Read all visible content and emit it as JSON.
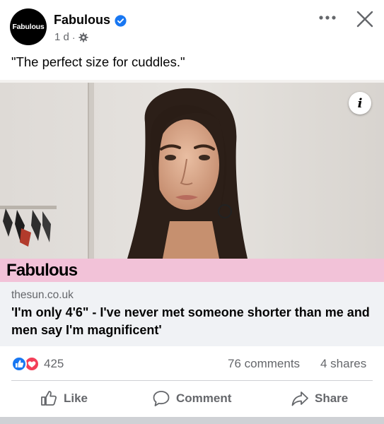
{
  "post": {
    "page_name": "Fabulous",
    "avatar_text": "Fabulous",
    "time": "1 d",
    "separator": "·",
    "caption": "\"The perfect size for cuddles.\""
  },
  "media": {
    "brand": "Fabulous",
    "info_label": "i"
  },
  "link": {
    "domain": "thesun.co.uk",
    "headline": "'I'm only 4'6\" - I've never met someone shorter than me and men say I'm magnificent'"
  },
  "stats": {
    "reactions": "425",
    "comments": "76 comments",
    "shares": "4 shares"
  },
  "actions": {
    "like": "Like",
    "comment": "Comment",
    "share": "Share"
  },
  "colors": {
    "brand_bar": "#f2c2d8",
    "verified": "#1877f2",
    "like_blue": "#1877f2",
    "love_red": "#f33e58",
    "secondary_text": "#65676b"
  },
  "icons": [
    "verified-badge-icon",
    "privacy-gear-icon",
    "more-options-icon",
    "close-icon",
    "info-icon",
    "like-reaction-icon",
    "love-reaction-icon",
    "thumbs-up-icon",
    "comment-bubble-icon",
    "share-arrow-icon"
  ]
}
